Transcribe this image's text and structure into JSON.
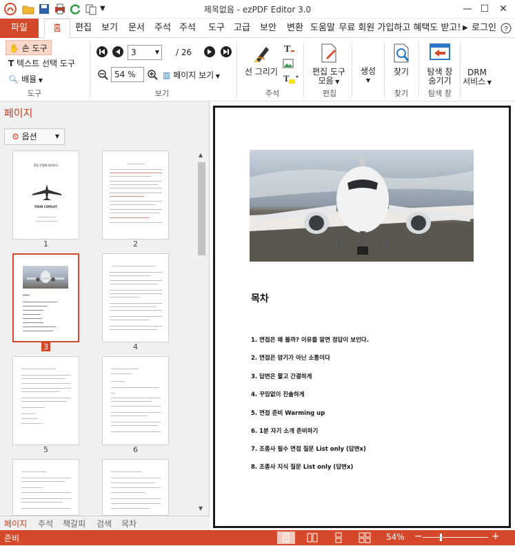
{
  "window": {
    "title": "제목없음 - ezPDF Editor 3.0"
  },
  "quick_access": [
    "app-logo-icon",
    "open-icon",
    "save-icon",
    "print-icon",
    "refresh-icon",
    "compare-icon",
    "dropdown-icon"
  ],
  "tabs": {
    "file": "파일",
    "items": [
      "홈",
      "편집",
      "보기",
      "문서",
      "주석",
      "주석",
      "도구",
      "고급",
      "보안",
      "변환",
      "도움말"
    ],
    "promo": "무료 회원 가입하고 혜택도 받고!",
    "login": "로그인"
  },
  "ribbon": {
    "tools": {
      "hand": "손 도구",
      "text_select": "텍스트 선택 도구",
      "zoom": "배율",
      "label": "도구"
    },
    "view": {
      "page_value": "3",
      "page_total": "/ 26",
      "zoom_value": "54 %",
      "page_view": "페이지 보기",
      "label": "보기"
    },
    "annot": {
      "line": "선 그리기",
      "label": "주석"
    },
    "edit": {
      "tools1": "편집 도구",
      "tools2": "모음",
      "label": "편집"
    },
    "create": {
      "label_btn": "생성"
    },
    "find": {
      "btn": "찾기",
      "label": "찾기"
    },
    "nav": {
      "btn1": "탐색 창",
      "btn2": "숨기기",
      "label": "탐색 창"
    },
    "drm": {
      "btn1": "DRM",
      "btn2": "서비스"
    }
  },
  "panel": {
    "title": "페이지",
    "options": "옵션",
    "thumbs": [
      "1",
      "2",
      "3",
      "4",
      "5",
      "6"
    ],
    "thumb1": {
      "title": "면접 전쟁에 대처하다",
      "sub": "YOUR COPILOT"
    },
    "bottom_tabs": [
      "페이지",
      "주석",
      "책갈피",
      "검색",
      "목차"
    ]
  },
  "doc": {
    "heading": "목차",
    "toc": [
      "1. 면접은 왜 볼까? 이유를 알면 정답이 보인다.",
      "2. 면접은 암기가 아닌 소통이다",
      "3. 답변은 짧고 간결하게",
      "4. 꾸밈없이 진솔하게",
      "5. 면접 준비 Warming up",
      "6. 1분 자기 소개 준비하기",
      "7. 조종사 필수 면접 질문 List only (답변x)",
      "8. 조종사 지식 질문 List only (답변x)"
    ]
  },
  "status": {
    "text": "준비",
    "zoom": "54%",
    "minus": "−",
    "plus": "+"
  },
  "colors": {
    "accent": "#d5482a",
    "ribbon_bg": "#ffffff",
    "panel_bg": "#f0f0f0"
  }
}
